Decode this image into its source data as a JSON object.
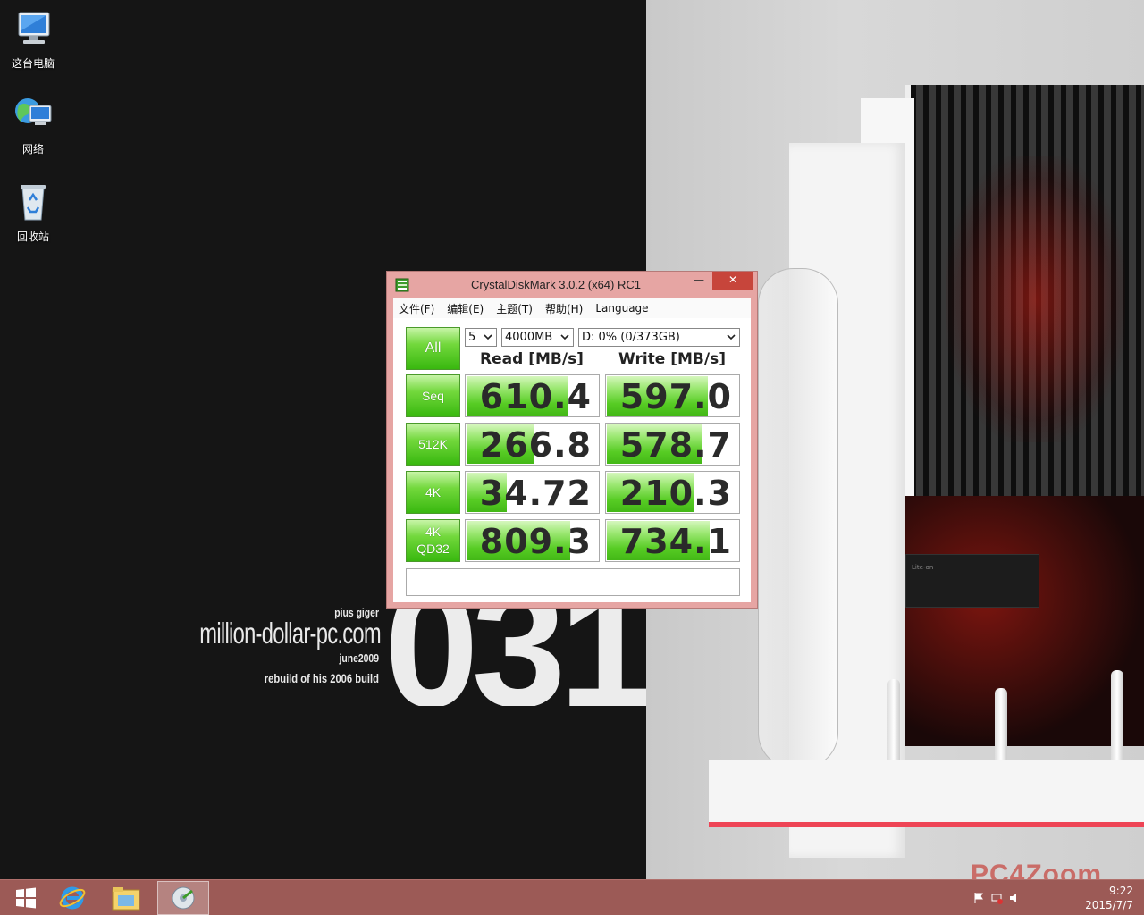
{
  "desktop": {
    "icons": [
      {
        "label": "这台电脑",
        "icon": "computer-icon"
      },
      {
        "label": "网络",
        "icon": "network-icon"
      },
      {
        "label": "回收站",
        "icon": "recycle-bin-icon"
      }
    ]
  },
  "wallpaper": {
    "author": "pius giger",
    "site": "million-dollar-pc.com",
    "date": "june2009",
    "subtitle": "rebuild of his 2006 build",
    "big_number": "031",
    "drive_brand": "Lite-on"
  },
  "window": {
    "title": "CrystalDiskMark 3.0.2 (x64) RC1",
    "buttons": {
      "minimize": "—",
      "maximize": "□",
      "close": "✕"
    },
    "menu": [
      "文件(F)",
      "编辑(E)",
      "主题(T)",
      "帮助(H)",
      "Language"
    ],
    "all_label": "All",
    "test_count": "5",
    "test_size": "4000MB",
    "drive": "D: 0% (0/373GB)",
    "read_header": "Read [MB/s]",
    "write_header": "Write [MB/s]",
    "rows": [
      {
        "label": "Seq",
        "read": "610.4",
        "write": "597.0",
        "read_fill": 0.76,
        "write_fill": 0.76
      },
      {
        "label": "512K",
        "read": "266.8",
        "write": "578.7",
        "read_fill": 0.5,
        "write_fill": 0.72
      },
      {
        "label": "4K",
        "read": "34.72",
        "write": "210.3",
        "read_fill": 0.3,
        "write_fill": 0.65
      },
      {
        "label": "4K\nQD32",
        "read": "809.3",
        "write": "734.1",
        "read_fill": 0.78,
        "write_fill": 0.77
      }
    ],
    "status": ""
  },
  "taskbar": {
    "items": [
      "start-icon",
      "internet-explorer-icon",
      "file-explorer-icon",
      "crystaldiskmark-icon"
    ],
    "clock_time": "9:22",
    "clock_date": "2015/7/7",
    "watermark": "PC4Zoom"
  },
  "colors": {
    "taskbar": "#9c5a56",
    "window_frame": "#e6a5a3",
    "close_button": "#c7453b",
    "bar_green": "#57cc24"
  }
}
